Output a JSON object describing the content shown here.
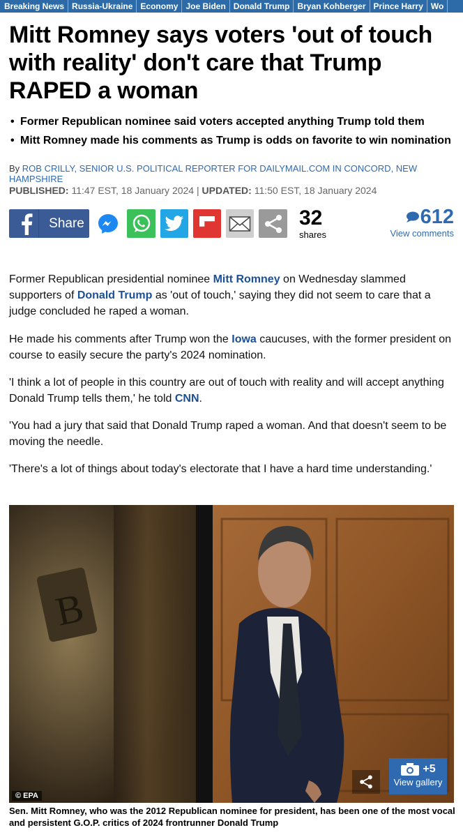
{
  "nav": {
    "items": [
      "Breaking News",
      "Russia-Ukraine",
      "Economy",
      "Joe Biden",
      "Donald Trump",
      "Bryan Kohberger",
      "Prince Harry",
      "Wo"
    ]
  },
  "article": {
    "headline": "Mitt Romney says voters 'out of touch with reality' don't care that Trump RAPED a woman",
    "bullets": [
      "Former Republican nominee said voters accepted anything Trump told them",
      "Mitt Romney made his comments as Trump is odds on favorite to win nomination"
    ],
    "byline_prefix": "By",
    "author": "ROB CRILLY, SENIOR U.S. POLITICAL REPORTER FOR DAILYMAIL.COM IN CONCORD, NEW HAMPSHIRE",
    "published_label": "PUBLISHED:",
    "published_value": "11:47 EST, 18 January 2024",
    "separator": "|",
    "updated_label": "UPDATED:",
    "updated_value": "11:50 EST, 18 January 2024"
  },
  "share": {
    "facebook_label": "Share",
    "count": "32",
    "count_label": "shares",
    "comments_count": "612",
    "comments_label": "View comments",
    "icons": [
      "facebook-icon",
      "messenger-icon",
      "whatsapp-icon",
      "twitter-icon",
      "flipboard-icon",
      "email-icon",
      "share-icon"
    ]
  },
  "body": {
    "p1": {
      "a": "Former Republican presidential nominee ",
      "link1": "Mitt Romney",
      "b": " on Wednesday slammed supporters of ",
      "link2": "Donald Trump",
      "c": " as 'out of touch,' saying they did not seem to care that a judge concluded he raped a woman."
    },
    "p2": {
      "a": "He made his comments after Trump won the ",
      "link1": "Iowa",
      "b": " caucuses, with the former president on course to easily secure the party's 2024 nomination."
    },
    "p3": {
      "a": "'I think a lot of people in this country are out of touch with reality and will accept anything Donald Trump tells them,' he told ",
      "link1": "CNN",
      "b": "."
    },
    "p4": "'You had a jury that said that Donald Trump raped a woman. And that doesn't seem to be moving the needle.",
    "p5": "'There's a lot of things about today's electorate that I have a hard time understanding.'"
  },
  "image": {
    "credit": "© EPA",
    "gallery_plus": "+5",
    "gallery_label": "View gallery",
    "caption": "Sen. Mitt Romney, who was the 2012 Republican nominee for president, has been one of the most vocal and persistent G.O.P. critics of 2024 frontrunner Donald Trump"
  },
  "colors": {
    "nav_bg": "#2c6ba8",
    "link": "#1b4f96",
    "facebook": "#3b5b96",
    "whatsapp": "#3cc15a",
    "twitter": "#23a6e6",
    "flipboard": "#e03631"
  }
}
